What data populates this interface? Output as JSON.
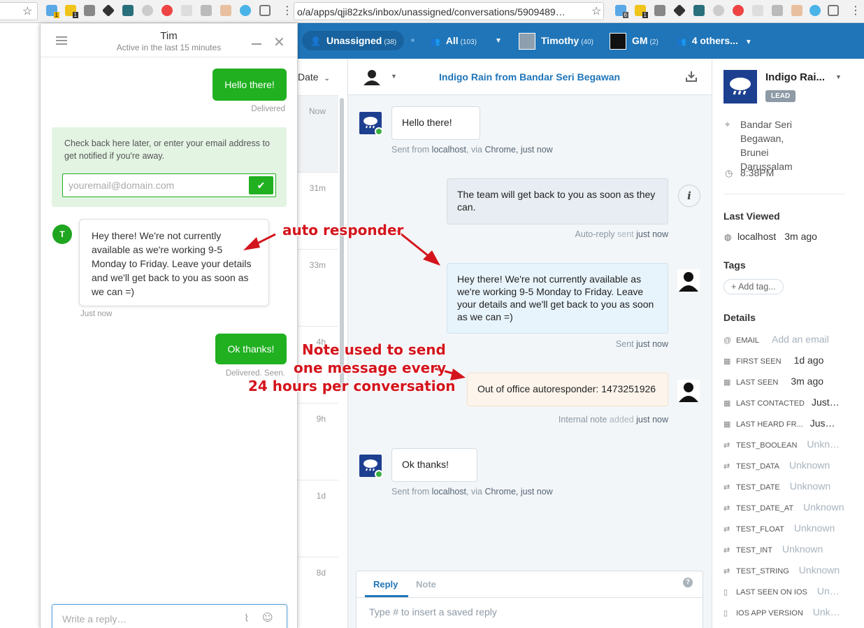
{
  "browser": {
    "url_right": "o/a/apps/qji82zks/inbox/unassigned/conversations/5909489…",
    "ext_badge_1": "1",
    "ext_badge_2": "1",
    "ext_badge_3": "6",
    "ext_badge_4": "1"
  },
  "topbar": {
    "unassigned_label": "Unassigned",
    "unassigned_count": "(38)",
    "all_label": "All",
    "all_count": "(103)",
    "timothy_label": "Timothy",
    "timothy_count": "(40)",
    "gm_label": "GM",
    "gm_count": "(2)",
    "others_label": "4 others..."
  },
  "convlist": {
    "sort_label": "Date",
    "times": [
      "Now",
      "31m",
      "33m",
      "4h",
      "9h",
      "1d",
      "8d"
    ]
  },
  "conversation": {
    "title": "Indigo Rain from Bandar Seri Begawan",
    "messages": [
      {
        "text": "Hello there!",
        "meta_pre": "Sent from",
        "meta_host": "localhost",
        "meta_via": ", via",
        "meta_browser": "Chrome",
        "meta_time": ", just now"
      },
      {
        "text": "The team will get back to you as soon as they can.",
        "meta_pre": "Auto-reply",
        "meta_mid": "sent",
        "meta_time": "just now"
      },
      {
        "text": "Hey there! We're not currently available as we're working 9-5 Monday to Friday. Leave your details and we'll get back to you as soon as we can =)",
        "meta_pre": "Sent",
        "meta_time": "just now"
      },
      {
        "text": "Out of office autoresponder: 1473251926",
        "meta_pre": "Internal note",
        "meta_mid": "added",
        "meta_time": "just now"
      },
      {
        "text": "Ok thanks!",
        "meta_pre": "Sent from",
        "meta_host": "localhost",
        "meta_via": ", via",
        "meta_browser": "Chrome",
        "meta_time": ", just now"
      }
    ],
    "composer": {
      "tab_reply": "Reply",
      "tab_note": "Note",
      "placeholder": "Type # to insert a saved reply"
    }
  },
  "sidebar": {
    "name": "Indigo Rai...",
    "badge": "LEAD",
    "location": "Bandar Seri Begawan, Brunei Darussalam",
    "local_time": "8:38PM",
    "last_viewed_heading": "Last Viewed",
    "last_viewed_host": "localhost",
    "last_viewed_time": "3m ago",
    "tags_heading": "Tags",
    "add_tag": "+ Add tag...",
    "details_heading": "Details",
    "details": [
      {
        "key": "EMAIL",
        "value": "Add an email",
        "muted": true
      },
      {
        "key": "FIRST SEEN",
        "value": "1d ago",
        "muted": false
      },
      {
        "key": "LAST SEEN",
        "value": "3m ago",
        "muted": false
      },
      {
        "key": "LAST CONTACTED",
        "value": "Just…",
        "muted": false
      },
      {
        "key": "LAST HEARD FR...",
        "value": "Jus…",
        "muted": false
      },
      {
        "key": "TEST_BOOLEAN",
        "value": "Unkn…",
        "muted": true
      },
      {
        "key": "TEST_DATA",
        "value": "Unknown",
        "muted": true
      },
      {
        "key": "TEST_DATE",
        "value": "Unknown",
        "muted": true
      },
      {
        "key": "TEST_DATE_AT",
        "value": "Unknown",
        "muted": true
      },
      {
        "key": "TEST_FLOAT",
        "value": "Unknown",
        "muted": true
      },
      {
        "key": "TEST_INT",
        "value": "Unknown",
        "muted": true
      },
      {
        "key": "TEST_STRING",
        "value": "Unknown",
        "muted": true
      },
      {
        "key": "LAST SEEN ON IOS",
        "value": "Un…",
        "muted": true
      },
      {
        "key": "IOS APP VERSION",
        "value": "Unk…",
        "muted": true
      }
    ]
  },
  "widget": {
    "name": "Tim",
    "status": "Active in the last 15 minutes",
    "msg1": "Hello there!",
    "msg1_status": "Delivered",
    "notice": "Check back here later, or enter your email address to get notified if you're away.",
    "email_placeholder": "youremail@domain.com",
    "avatar_letter": "T",
    "auto_reply": "Hey there! We're not currently available as we're working 9-5 Monday to Friday. Leave your details and we'll get back to you as soon as we can =)",
    "auto_reply_time": "Just now",
    "msg2": "Ok thanks!",
    "msg2_status": "Delivered. Seen.",
    "reply_placeholder": "Write a reply…"
  },
  "annotations": {
    "auto_responder": "auto responder",
    "note_line1": "Note used to send",
    "note_line2": "one message every",
    "note_line3": "24 hours per conversation"
  },
  "colors": {
    "topbar": "#1f75b8",
    "widget_green": "#20b020",
    "annotation_red": "#d4141c"
  }
}
